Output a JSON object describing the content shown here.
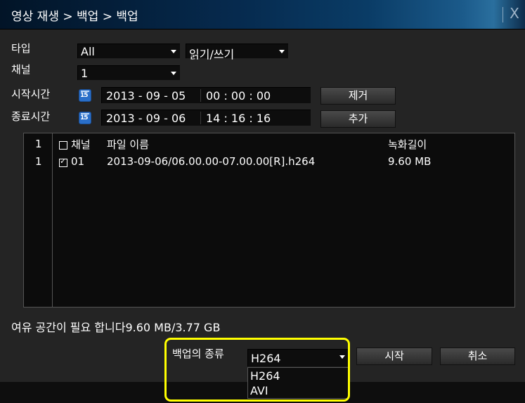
{
  "window": {
    "title": "영상 재생 > 백업 > 백업",
    "close_label": "X"
  },
  "form": {
    "type_label": "타입",
    "type_value": "All",
    "mode_value": "읽기/쓰기",
    "channel_label": "채널",
    "channel_value": "1",
    "start_label": "시작시간",
    "start_date": "2013 - 09 - 05",
    "start_time": "00 : 00 : 00",
    "end_label": "종료시간",
    "end_date": "2013 - 09 - 06",
    "end_time": "14 : 16 : 16",
    "remove_button": "제거",
    "add_button": "추가"
  },
  "file_list": {
    "columns": [
      "채널",
      "파일 이름",
      "녹화길이"
    ],
    "header_index": "1",
    "rows": [
      {
        "index": "1",
        "checked": true,
        "channel": "01",
        "filename": "2013-09-06/06.00.00-07.00.00[R].h264",
        "size": "9.60 MB"
      }
    ]
  },
  "footer": {
    "space_info": "여유 공간이 필요 합니다9.60 MB/3.77 GB"
  },
  "backup": {
    "type_label": "백업의 종류",
    "type_value": "H264",
    "type_options": [
      "H264",
      "AVI"
    ],
    "start_button": "시작",
    "cancel_button": "취소"
  },
  "colors": {
    "highlight": "#ffff00",
    "title_bar": "#062a4e",
    "background": "#242424"
  }
}
